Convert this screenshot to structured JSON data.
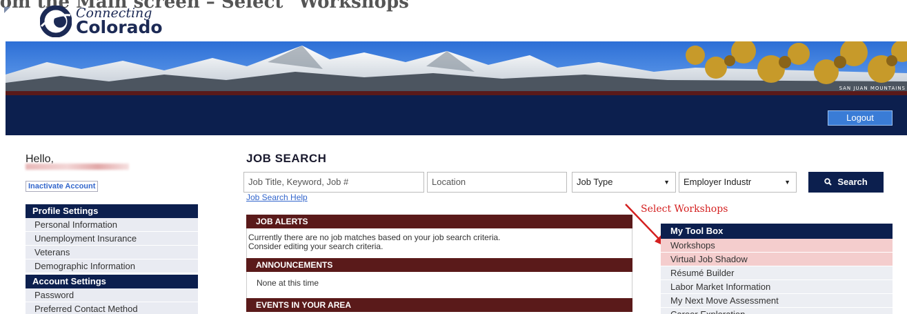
{
  "slide_title": "rom the Main screen – Select \"Workshops\"",
  "logo": {
    "line1": "Connecting",
    "line2": "Colorado"
  },
  "banner": {
    "caption": "SAN JUAN MOUNTAINS"
  },
  "header": {
    "logout_label": "Logout"
  },
  "sidebar": {
    "greeting": "Hello,",
    "inactivate_label": "Inactivate Account",
    "profile_heading": "Profile Settings",
    "profile_items": [
      "Personal Information",
      "Unemployment Insurance",
      "Veterans",
      "Demographic Information"
    ],
    "account_heading": "Account Settings",
    "account_items": [
      "Password",
      "Preferred Contact Method"
    ]
  },
  "job_search": {
    "title": "JOB SEARCH",
    "keyword_placeholder": "Job Title, Keyword, Job #",
    "location_placeholder": "Location",
    "job_type": "Job Type",
    "employer_industry": "Employer Industr",
    "search_label": "Search",
    "help_link": "Job Search Help"
  },
  "panels": {
    "job_alerts_heading": "JOB ALERTS",
    "job_alerts_line1": "Currently there are no job matches based on your job search criteria.",
    "job_alerts_line2": "Consider editing your search criteria.",
    "announcements_heading": "ANNOUNCEMENTS",
    "announcements_text": "None at this time",
    "events_heading": "EVENTS IN YOUR AREA"
  },
  "annotation": {
    "text": "Select Workshops",
    "color": "#d42020"
  },
  "toolbox": {
    "heading": "My Tool Box",
    "items": [
      "Workshops",
      "Virtual Job Shadow",
      "Résumé Builder",
      "Labor Market Information",
      "My Next Move Assessment",
      "Career Exploration"
    ]
  },
  "colors": {
    "navy": "#0c1f4e",
    "maroon": "#5a1a1a",
    "highlight": "#f4cdcd",
    "link": "#3366cc"
  }
}
